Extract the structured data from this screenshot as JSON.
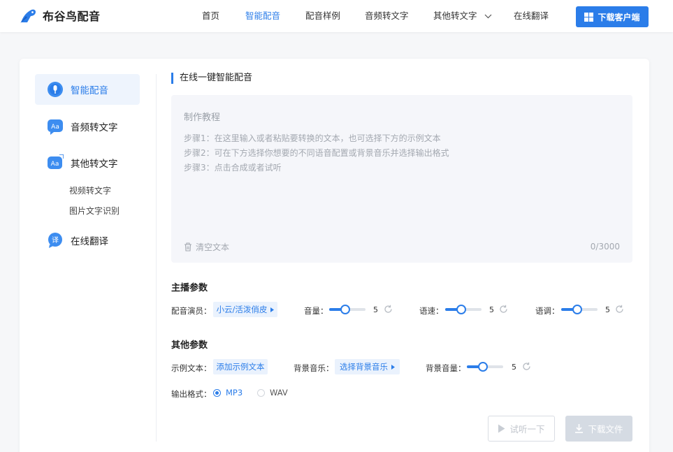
{
  "header": {
    "logo_text": "布谷鸟配音",
    "nav": [
      "首页",
      "智能配音",
      "配音样例",
      "音频转文字",
      "其他转文字",
      "在线翻译"
    ],
    "active_nav": "智能配音",
    "download_client": "下载客户端"
  },
  "sidebar": {
    "items": [
      {
        "label": "智能配音",
        "icon": "mic-icon",
        "active": true
      },
      {
        "label": "音频转文字",
        "icon": "aa-text-icon",
        "active": false
      },
      {
        "label": "其他转文字",
        "icon": "aa-text-icon",
        "active": false
      },
      {
        "label": "在线翻译",
        "icon": "translate-icon",
        "active": false
      }
    ],
    "sub_items": [
      "视频转文字",
      "图片文字识别"
    ]
  },
  "main": {
    "section_title": "在线一键智能配音",
    "editor": {
      "title": "制作教程",
      "steps": [
        "步骤1：在这里输入或者粘贴要转换的文本，也可选择下方的示例文本",
        "步骤2：可在下方选择你想要的不同语音配置或背景音乐并选择输出格式",
        "步骤3：点击合成或者试听"
      ],
      "clear": "清空文本",
      "counter": "0/3000"
    },
    "anchor_params": {
      "title": "主播参数",
      "voice_label": "配音演员：",
      "voice_value": "小云/活泼俏皮",
      "volume_label": "音量：",
      "volume_value": "5",
      "speed_label": "语速：",
      "speed_value": "5",
      "pitch_label": "语调：",
      "pitch_value": "5",
      "slider_level": 0.45
    },
    "other_params": {
      "title": "其他参数",
      "sample_label": "示例文本：",
      "sample_button": "添加示例文本",
      "bgm_label": "背景音乐：",
      "bgm_button": "选择背景音乐",
      "bgm_volume_label": "背景音量：",
      "bgm_volume_value": "5",
      "output_label": "输出格式：",
      "formats": [
        "MP3",
        "WAV"
      ],
      "selected_format": "MP3"
    },
    "actions": {
      "preview": "试听一下",
      "download": "下载文件"
    }
  },
  "colors": {
    "accent": "#2b7de9",
    "disabled": "#d5dbe3"
  }
}
